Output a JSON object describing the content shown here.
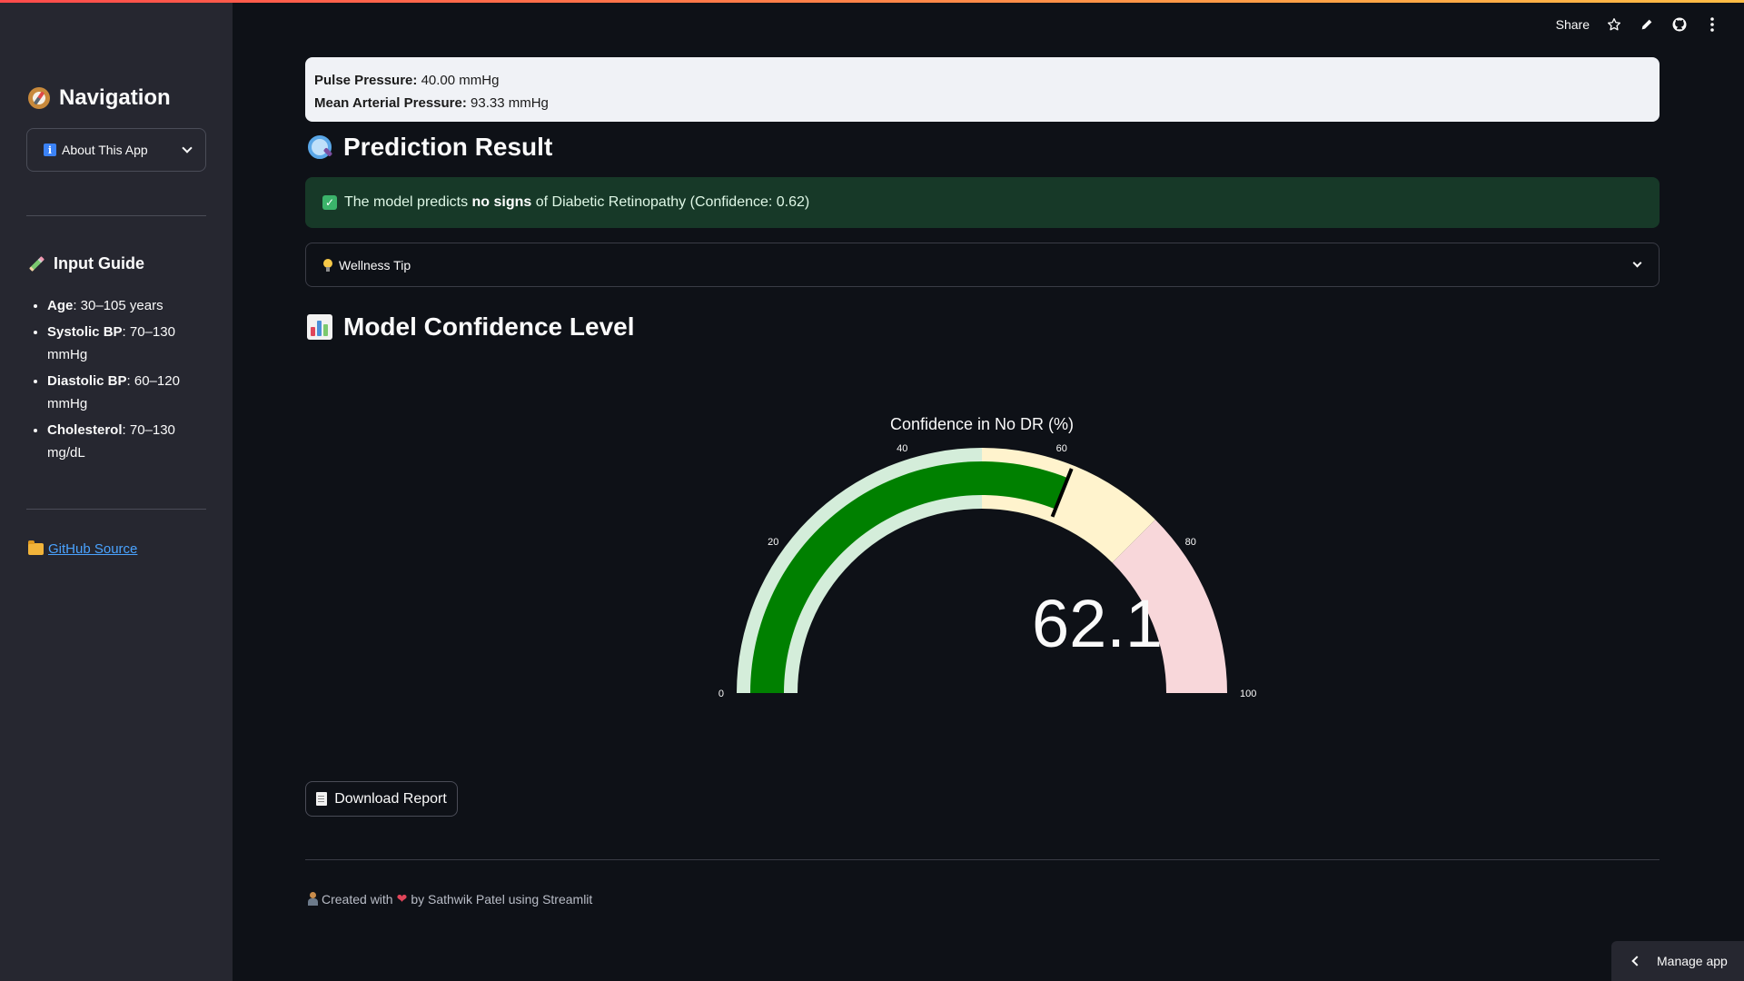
{
  "sidebar": {
    "nav_title": "Navigation",
    "select_value": "About This App",
    "guide_title": "Input Guide",
    "guide_items": [
      {
        "label": "Age",
        "value": ": 30–105 years"
      },
      {
        "label": "Systolic BP",
        "value": ": 70–130 mmHg"
      },
      {
        "label": "Diastolic BP",
        "value": ": 60–120 mmHg"
      },
      {
        "label": "Cholesterol",
        "value": ": 70–130 mg/dL"
      }
    ],
    "github_link": "GitHub Source"
  },
  "toolbar": {
    "share_label": "Share",
    "icons": [
      "star-icon",
      "pencil-icon",
      "github-icon",
      "more-vertical-icon"
    ]
  },
  "pressure": {
    "pulse_label": "Pulse Pressure:",
    "pulse_value": " 40.00 mmHg",
    "map_label": "Mean Arterial Pressure:",
    "map_value": " 93.33 mmHg"
  },
  "prediction": {
    "title": "Prediction Result",
    "message_prefix": "The model predicts ",
    "message_bold": "no signs",
    "message_suffix": " of Diabetic Retinopathy (Confidence: 0.62)"
  },
  "wellness": {
    "label": "Wellness Tip"
  },
  "confidence": {
    "title": "Model Confidence Level"
  },
  "chart_data": {
    "type": "gauge",
    "title": "Confidence in No DR (%)",
    "value": 62.1,
    "value_label": "62.1",
    "range": [
      0,
      100
    ],
    "ticks": [
      0,
      20,
      40,
      60,
      80,
      100
    ],
    "tick_labels": [
      "0",
      "20",
      "40",
      "60",
      "80",
      "100"
    ],
    "steps": [
      {
        "range": [
          0,
          50
        ],
        "color": "#d4edda"
      },
      {
        "range": [
          50,
          75
        ],
        "color": "#fff3cd"
      },
      {
        "range": [
          75,
          100
        ],
        "color": "#f8d7da"
      }
    ],
    "bar_color": "#008000",
    "threshold": 62.1
  },
  "download": {
    "label": "Download Report"
  },
  "footer": {
    "prefix": "Created with",
    "suffix": "by Sathwik Patel using Streamlit"
  },
  "manage_app": {
    "label": "Manage app"
  }
}
